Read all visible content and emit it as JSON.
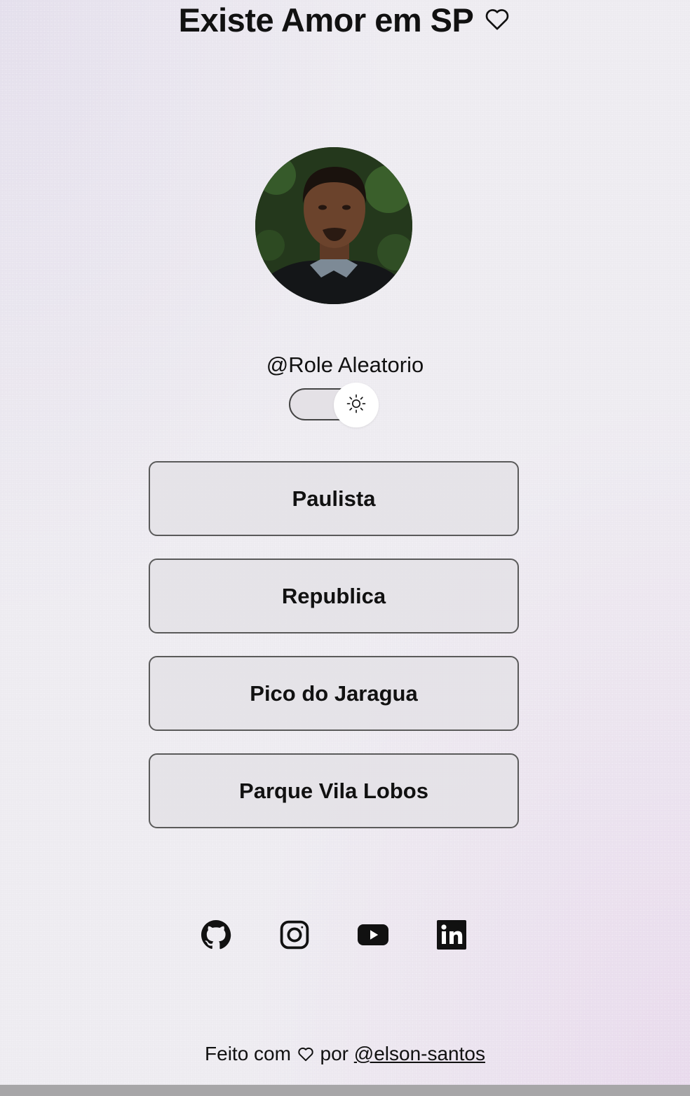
{
  "page": {
    "title": "Existe Amor em SP",
    "title_icon": "heart-outline-icon"
  },
  "profile": {
    "avatar_alt": "profile-photo",
    "handle": "@Role Aleatorio"
  },
  "theme_toggle": {
    "icon": "sun-icon",
    "state": "light"
  },
  "links": [
    {
      "label": "Paulista"
    },
    {
      "label": "Republica"
    },
    {
      "label": "Pico do Jaragua"
    },
    {
      "label": "Parque Vila Lobos"
    }
  ],
  "socials": [
    {
      "icon": "github-icon"
    },
    {
      "icon": "instagram-icon"
    },
    {
      "icon": "youtube-icon"
    },
    {
      "icon": "linkedin-icon"
    }
  ],
  "footer": {
    "prefix": "Feito com",
    "middle": "por",
    "author_link": "@elson-santos"
  },
  "colors": {
    "background": "#efedf2",
    "button_bg": "#e4e1e6",
    "button_border": "#5a5a5a",
    "text": "#111111"
  }
}
